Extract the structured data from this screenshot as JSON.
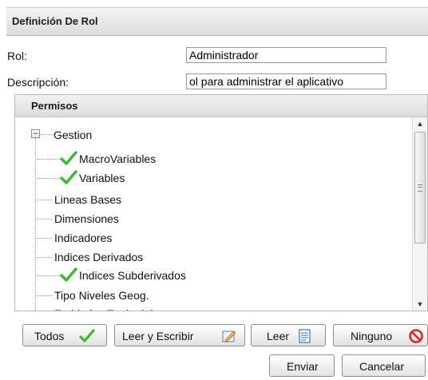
{
  "panel": {
    "title": "Definición De Rol"
  },
  "form": {
    "rol_label": "Rol:",
    "rol_value": "Administrador",
    "descripcion_label": "Descripción:",
    "descripcion_value": "ol para administrar el aplicativo"
  },
  "permisos": {
    "title": "Permisos",
    "root": {
      "label": "Gestion",
      "expanded": true
    },
    "items": [
      {
        "label": "MacroVariables",
        "checked": true
      },
      {
        "label": "Variables",
        "checked": true
      },
      {
        "label": "Lineas Bases",
        "checked": false
      },
      {
        "label": "Dimensiones",
        "checked": false
      },
      {
        "label": "Indicadores",
        "checked": false
      },
      {
        "label": "Indices Derivados",
        "checked": false
      },
      {
        "label": "Indices Subderivados",
        "checked": true
      },
      {
        "label": "Tipo Niveles Geog.",
        "checked": false
      },
      {
        "label": "Entidades Territoriales",
        "checked": false
      }
    ]
  },
  "buttons": {
    "todos": "Todos",
    "leer_escribir": "Leer y Escribir",
    "leer": "Leer",
    "ninguno": "Ninguno",
    "enviar": "Enviar",
    "cancelar": "Cancelar"
  },
  "icons": {
    "check": "green-check-icon",
    "edit": "pencil-icon",
    "read": "document-icon",
    "none": "prohibited-icon"
  },
  "colors": {
    "check_green": "#3cb92f",
    "none_red": "#d8262b",
    "edit_blue": "#3b6fb6"
  }
}
